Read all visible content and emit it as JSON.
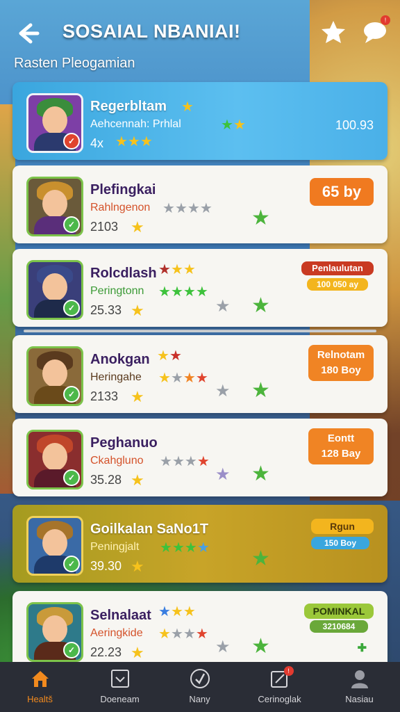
{
  "header": {
    "title": "SOSAIAL NBANIAI!",
    "subtitle": "Rasten Pleogamian",
    "icons": [
      "back-arrow-icon",
      "star-icon",
      "chat-bubble-icon"
    ]
  },
  "colors": {
    "accent": "#f28a1e",
    "brand_blue": "#3aa6de",
    "green": "#4cb43c",
    "gold": "#c8a428"
  },
  "items": [
    {
      "name": "Regerbltam",
      "sub": "Aehcennah: Prhlal",
      "count": "4x",
      "score": "100.93",
      "badge": null,
      "badge2": null,
      "badge_color": null
    },
    {
      "name": "Plefingkai",
      "sub": "Rahlngenon",
      "count": "2103",
      "score": null,
      "badge": "65 by",
      "badge2": null,
      "badge_color": "#f07a20"
    },
    {
      "name": "Rolcdlash",
      "sub": "Peringtonn",
      "count": "25.33",
      "score": null,
      "badge": "Penlaulutan",
      "badge2": "100 050 ay",
      "badge_color": "#d23a24"
    },
    {
      "name": "Anokgan",
      "sub": "Heringahe",
      "count": "2133",
      "score": null,
      "badge": "Relnotam",
      "badge2": "180 Boy",
      "badge_color": "#f08424"
    },
    {
      "name": "Peghanuo",
      "sub": "Ckahgluno",
      "count": "35.28",
      "score": null,
      "badge": "Eontt",
      "badge2": "128 Bay",
      "badge_color": "#f08424"
    },
    {
      "name": "Goilkalan SaNo1T",
      "sub": "Peningjalt",
      "count": "39.30",
      "score": null,
      "badge": "Rgun",
      "badge2": "150 Boy",
      "badge_color": "#f3b51e"
    },
    {
      "name": "Selnalaat",
      "sub": "Aeringkide",
      "count": "22.23",
      "score": null,
      "badge": "POMINKAL",
      "badge2": "3210684",
      "badge_color": "#9bc83a"
    }
  ],
  "nav": [
    {
      "label": "Healtš",
      "icon": "home-icon",
      "active": true
    },
    {
      "label": "Doeneam",
      "icon": "inbox-icon",
      "active": false
    },
    {
      "label": "Nany",
      "icon": "check-circle-icon",
      "active": false
    },
    {
      "label": "Cerinoglak",
      "icon": "notification-icon",
      "active": false
    },
    {
      "label": "Nasiau",
      "icon": "profile-icon",
      "active": false
    }
  ]
}
